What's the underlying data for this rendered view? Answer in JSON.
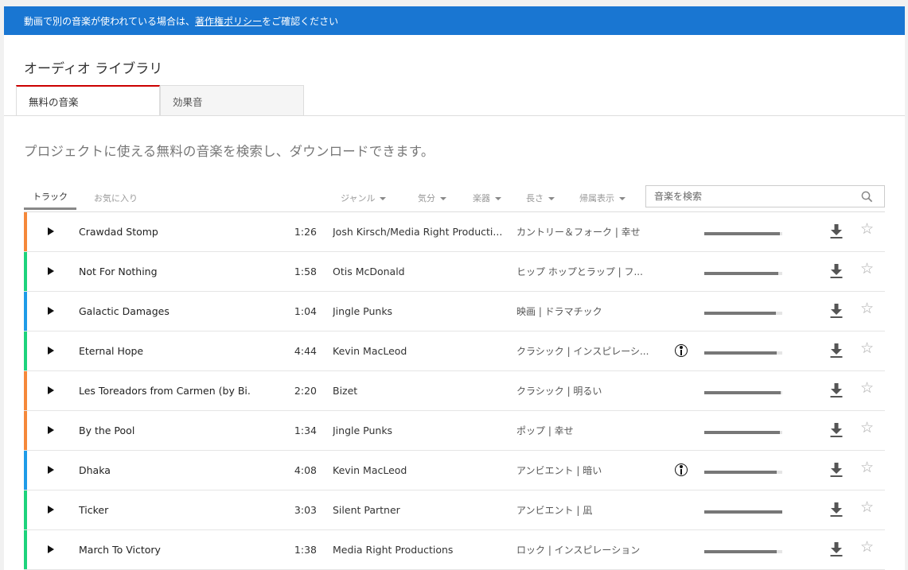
{
  "banner": {
    "prefix": "動画で別の音楽が使われている場合は、",
    "link": "著作権ポリシー",
    "suffix": "をご確認ください"
  },
  "title": "オーディオ ライブラリ",
  "tabs": [
    {
      "label": "無料の音楽",
      "active": true
    },
    {
      "label": "効果音",
      "active": false
    }
  ],
  "subtitle": "プロジェクトに使える無料の音楽を検索し、ダウンロードできます。",
  "filters": {
    "tracks_tab": "トラック",
    "favorites_tab": "お気に入り",
    "dropdowns": [
      "ジャンル",
      "気分",
      "楽器",
      "長さ",
      "帰属表示"
    ],
    "search_placeholder": "音楽を検索"
  },
  "colors": {
    "banner": "#1976d2",
    "active_tab": "#cc0000",
    "orange": "#f5883a",
    "green": "#1dd37c",
    "blue": "#1e9be8"
  },
  "tracks": [
    {
      "name": "Crawdad Stomp",
      "duration": "1:26",
      "artist": "Josh Kirsch/Media Right Producti...",
      "genre": "カントリー＆フォーク | 幸せ",
      "attribution": false,
      "stripe": "#f5883a",
      "progress": 0.97
    },
    {
      "name": "Not For Nothing",
      "duration": "1:58",
      "artist": "Otis McDonald",
      "genre": "ヒップ ホップとラップ | フ...",
      "attribution": false,
      "stripe": "#1dd37c",
      "progress": 0.95
    },
    {
      "name": "Galactic Damages",
      "duration": "1:04",
      "artist": "Jingle Punks",
      "genre": "映画 | ドラマチック",
      "attribution": false,
      "stripe": "#1e9be8",
      "progress": 0.92
    },
    {
      "name": "Eternal Hope",
      "duration": "4:44",
      "artist": "Kevin MacLeod",
      "genre": "クラシック | インスピレーシ...",
      "attribution": true,
      "stripe": "#1dd37c",
      "progress": 0.93
    },
    {
      "name": "Les Toreadors from Carmen (by Bi...",
      "duration": "2:20",
      "artist": "Bizet",
      "genre": "クラシック | 明るい",
      "attribution": false,
      "stripe": "#f5883a",
      "progress": 0.98
    },
    {
      "name": "By the Pool",
      "duration": "1:34",
      "artist": "Jingle Punks",
      "genre": "ポップ | 幸せ",
      "attribution": false,
      "stripe": "#f5883a",
      "progress": 0.97
    },
    {
      "name": "Dhaka",
      "duration": "4:08",
      "artist": "Kevin MacLeod",
      "genre": "アンビエント | 暗い",
      "attribution": true,
      "stripe": "#1e9be8",
      "progress": 0.93
    },
    {
      "name": "Ticker",
      "duration": "3:03",
      "artist": "Silent Partner",
      "genre": "アンビエント | 凪",
      "attribution": false,
      "stripe": "#1dd37c",
      "progress": 1.0
    },
    {
      "name": "March To Victory",
      "duration": "1:38",
      "artist": "Media Right Productions",
      "genre": "ロック | インスピレーション",
      "attribution": false,
      "stripe": "#1dd37c",
      "progress": 0.93
    }
  ]
}
